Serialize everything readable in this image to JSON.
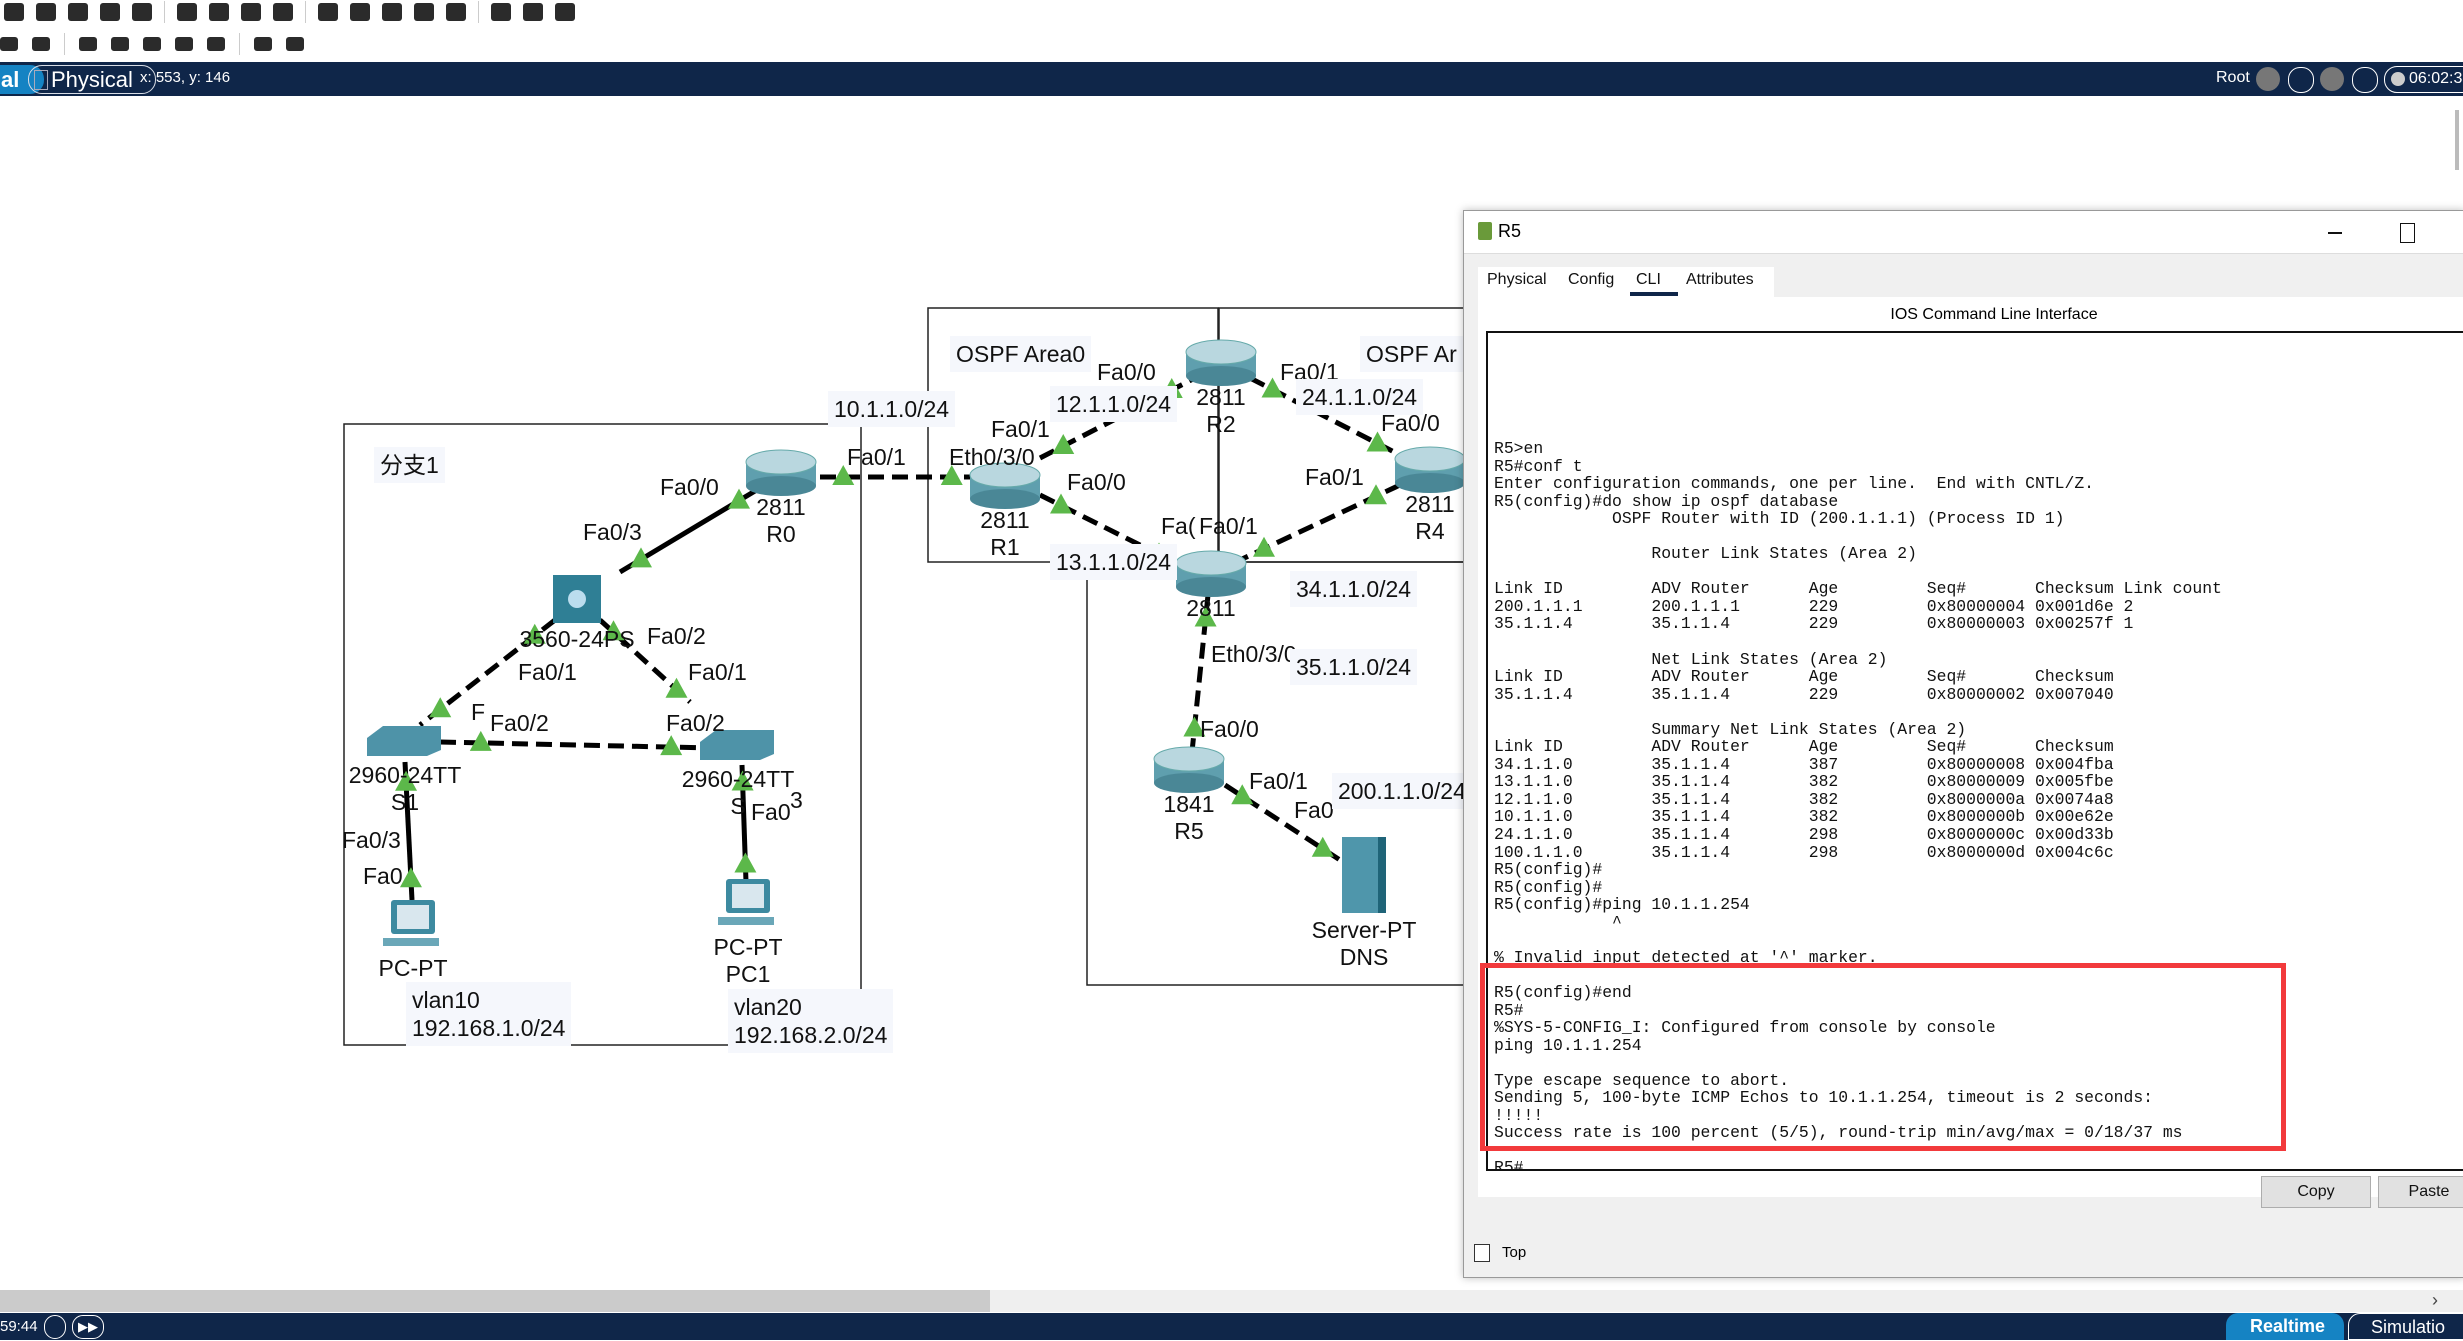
{
  "toolbar": {
    "icons_row1": [
      "save-icon",
      "print-icon",
      "info-icon",
      "user-icon",
      "wizard-icon",
      "copy-icon",
      "paste-icon",
      "undo-icon",
      "redo-icon",
      "zoom-in-icon",
      "zoom-reset-icon",
      "zoom-out-icon",
      "drawing-palette-icon",
      "custom-device-icon",
      "device-icon",
      "cluster-icon",
      "cloud-icon"
    ],
    "icons_row2": [
      "delete-icon",
      "resize-icon",
      "note-icon",
      "line-icon",
      "rectangle-icon",
      "ellipse-icon",
      "freeform-icon",
      "add-pdu-icon",
      "add-complex-pdu-icon"
    ]
  },
  "nav": {
    "logical_tab": "al",
    "physical_tab": "Physical",
    "coords": "x: 553, y: 146",
    "root": "Root",
    "time": "06:02:3"
  },
  "topology": {
    "link_up_color": "#5cb84a",
    "areas": {
      "branch1": "分支1",
      "area0": "OSPF Area0",
      "area_other": "OSPF Ar"
    },
    "networks": [
      "10.1.1.0/24",
      "12.1.1.0/24",
      "24.1.1.0/24",
      "13.1.1.0/24",
      "34.1.1.0/24",
      "35.1.1.0/24",
      "200.1.1.0/24"
    ],
    "vlans": [
      {
        "name": "vlan10",
        "subnet": "192.168.1.0/24"
      },
      {
        "name": "vlan20",
        "subnet": "192.168.2.0/24"
      }
    ],
    "interfaces": [
      "Fa0/0",
      "Fa0/1",
      "Fa0/0",
      "Fa0/1",
      "Fa0/1",
      "Eth0/3/0",
      "Fa0/0",
      "Fa0/1",
      "Fa0/0",
      "Fa0/3",
      "Fa(",
      "Fa0/1",
      "Fa0/2",
      "Eth0/3/0",
      "Fa0/1",
      "Fa0/1",
      "F",
      "Fa0/2",
      "Fa0/2",
      "Fa0/0",
      "Fa0/1",
      "Fa0",
      "Fa0",
      "3",
      "Fa0/3",
      "Fa0"
    ],
    "devices": [
      {
        "type": "router",
        "model": "2811",
        "name": "R0"
      },
      {
        "type": "router",
        "model": "2811",
        "name": "R1"
      },
      {
        "type": "router",
        "model": "2811",
        "name": "R2"
      },
      {
        "type": "router",
        "model": "2811",
        "name": ""
      },
      {
        "type": "router",
        "model": "2811",
        "name": "R4"
      },
      {
        "type": "router",
        "model": "1841",
        "name": "R5"
      },
      {
        "type": "server",
        "model": "Server-PT",
        "name": "DNS"
      },
      {
        "type": "multilayer-switch",
        "model": "3560-24PS",
        "name": ""
      },
      {
        "type": "switch",
        "model": "2960-24TT",
        "name": "S1"
      },
      {
        "type": "switch",
        "model": "2960-24TT",
        "name": "S"
      },
      {
        "type": "pc",
        "model": "PC-PT",
        "name": "P"
      },
      {
        "type": "pc",
        "model": "PC-PT",
        "name": "PC1"
      }
    ]
  },
  "window": {
    "title": "R5",
    "tabs": [
      "Physical",
      "Config",
      "CLI",
      "Attributes"
    ],
    "active_tab": "CLI",
    "header": "IOS Command Line Interface",
    "cli_lines": [
      "R5>en",
      "R5#conf t",
      "Enter configuration commands, one per line.  End with CNTL/Z.",
      "R5(config)#do show ip ospf database",
      "            OSPF Router with ID (200.1.1.1) (Process ID 1)",
      "",
      "                Router Link States (Area 2)",
      "",
      "Link ID         ADV Router      Age         Seq#       Checksum Link count",
      "200.1.1.1       200.1.1.1       229         0x80000004 0x001d6e 2",
      "35.1.1.4        35.1.1.4        229         0x80000003 0x00257f 1",
      "",
      "                Net Link States (Area 2)",
      "Link ID         ADV Router      Age         Seq#       Checksum",
      "35.1.1.4        35.1.1.4        229         0x80000002 0x007040",
      "",
      "                Summary Net Link States (Area 2)",
      "Link ID         ADV Router      Age         Seq#       Checksum",
      "34.1.1.0        35.1.1.4        387         0x80000008 0x004fba",
      "13.1.1.0        35.1.1.4        382         0x80000009 0x005fbe",
      "12.1.1.0        35.1.1.4        382         0x8000000a 0x0074a8",
      "10.1.1.0        35.1.1.4        382         0x8000000b 0x00e62e",
      "24.1.1.0        35.1.1.4        298         0x8000000c 0x00d33b",
      "100.1.1.0       35.1.1.4        298         0x8000000d 0x004c6c",
      "R5(config)#",
      "R5(config)#",
      "R5(config)#ping 10.1.1.254",
      "            ^",
      "",
      "% Invalid input detected at '^' marker.",
      "",
      "R5(config)#end",
      "R5#",
      "%SYS-5-CONFIG_I: Configured from console by console",
      "ping 10.1.1.254",
      "",
      "Type escape sequence to abort.",
      "Sending 5, 100-byte ICMP Echos to 10.1.1.254, timeout is 2 seconds:",
      "!!!!!",
      "Success rate is 100 percent (5/5), round-trip min/avg/max = 0/18/37 ms",
      "",
      "R5#"
    ],
    "highlight_color": "#f23a3c",
    "copy": "Copy",
    "paste": "Paste",
    "top_checkbox": "Top",
    "top_checked": false
  },
  "bottom": {
    "time": "59:44",
    "realtime": "Realtime",
    "simulation": "Simulatio"
  }
}
